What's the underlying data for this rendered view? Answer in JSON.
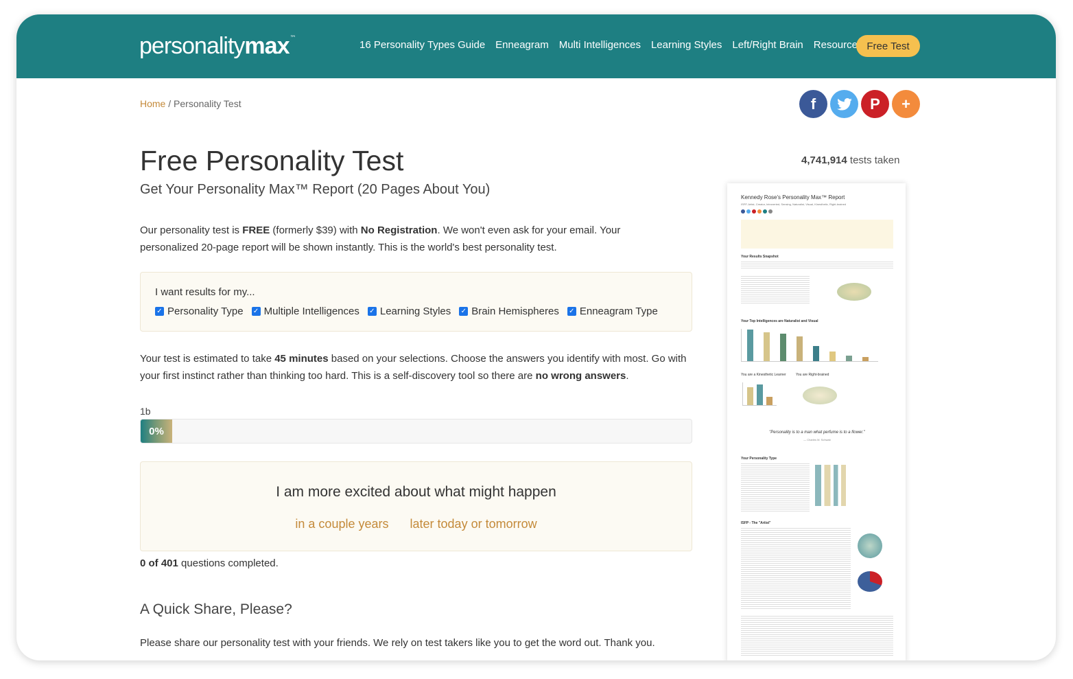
{
  "header": {
    "logo_light": "personality",
    "logo_bold": "max",
    "logo_tm": "™",
    "nav": [
      "16 Personality Types Guide",
      "Enneagram",
      "Multi Intelligences",
      "Learning Styles",
      "Left/Right Brain",
      "Resources"
    ],
    "cta": "Free Test"
  },
  "breadcrumb": {
    "home": "Home",
    "separator": " / ",
    "current": "Personality Test"
  },
  "share_icons": [
    "facebook-icon",
    "twitter-icon",
    "pinterest-icon",
    "plus-icon"
  ],
  "title": "Free Personality Test",
  "subtitle": "Get Your Personality Max™ Report (20 Pages About You)",
  "tests_taken": {
    "count": "4,741,914",
    "label": " tests taken"
  },
  "intro": {
    "t1": "Our personality test is ",
    "b1": "FREE",
    "t2": " (formerly $39) with ",
    "b2": "No Registration",
    "t3": ". We won't even ask for your email. Your personalized 20-page report will be shown instantly. This is the world's best personality test."
  },
  "results": {
    "title": "I want results for my...",
    "options": [
      "Personality Type",
      "Multiple Intelligences",
      "Learning Styles",
      "Brain Hemispheres",
      "Enneagram Type"
    ]
  },
  "estimate": {
    "t1": "Your test is estimated to take ",
    "b1": "45 minutes",
    "t2": " based on your selections. Choose the answers you identify with most. Go with your first instinct rather than thinking too hard. This is a self-discovery tool so there are ",
    "b2": "no wrong answers",
    "t3": "."
  },
  "progress": {
    "page_label": "1b",
    "percent_label": "0%",
    "fraction": 0
  },
  "question": {
    "text": "I am more excited about what might happen",
    "answers": [
      "in a couple years",
      "later today or tomorrow"
    ]
  },
  "completed": {
    "count": "0 of 401",
    "label": " questions completed."
  },
  "quick_share": {
    "heading": "A Quick Share, Please?",
    "text": "Please share our personality test with your friends. We rely on test takers like you to get the word out. Thank you."
  },
  "report": {
    "title": "Kennedy Rose's Personality Max™ Report",
    "subtitle": "ISFP, Artist, Creator, Introverted, Sensing, Naturalist, Visual, Kinesthetic, Right-brained",
    "snapshot": "Your Results Snapshot",
    "intelligences": "Your Top Intelligences are Naturalist and Visual",
    "learner": "You are a Kinesthetic Learner",
    "brained": "You are Right-brained",
    "quote": "\"Personality is to a man what perfume is to a flower.\"",
    "quote_author": "— Charles M. Schwab",
    "type_section": "Your Personality Type",
    "artist": "ISFP - The \"Artist\"",
    "bar_colors": [
      "#5a9aa0",
      "#d6c58a",
      "#5d8c6e",
      "#c9b27a",
      "#3d7f8a",
      "#e0c880",
      "#7aa090",
      "#c9a060"
    ]
  }
}
